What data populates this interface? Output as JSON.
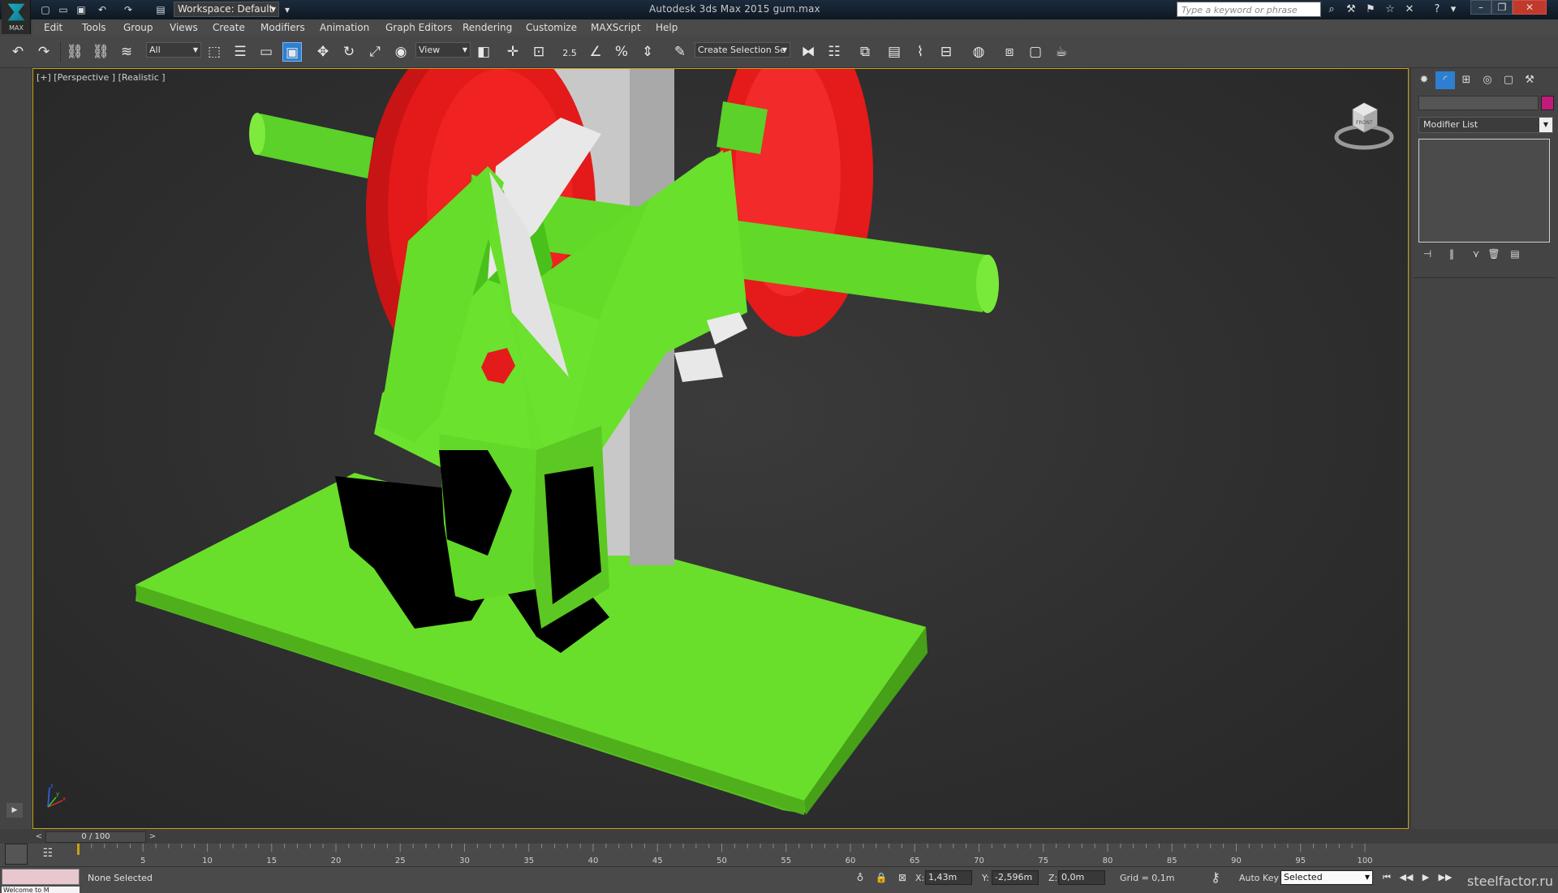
{
  "app": {
    "logo_text": "MAX",
    "window_title": "Autodesk 3ds Max  2015    gum.max",
    "workspace": "Workspace: Default",
    "search_placeholder": "Type a keyword or phrase"
  },
  "menu": [
    "Edit",
    "Tools",
    "Group",
    "Views",
    "Create",
    "Modifiers",
    "Animation",
    "Graph Editors",
    "Rendering",
    "Customize",
    "MAXScript",
    "Help"
  ],
  "toolbar": {
    "selection_filter": "All",
    "ref_coord": "View",
    "snap_value": "2.5",
    "named_selection": "Create Selection Se"
  },
  "viewport": {
    "label": "[+] [Perspective ] [Realistic ]",
    "viewcube_label": "FRONT",
    "axis_labels": [
      "x",
      "y",
      "z"
    ]
  },
  "command_panel": {
    "modifier_list": "Modifier List",
    "name_color": "#c21a7b"
  },
  "timeline": {
    "frame_counter": "0 / 100",
    "prev": "<",
    "next": ">",
    "ticks": [
      "5",
      "10",
      "15",
      "20",
      "25",
      "30",
      "35",
      "40",
      "45",
      "50",
      "55",
      "60",
      "65",
      "70",
      "75",
      "80",
      "85",
      "90",
      "95",
      "100"
    ]
  },
  "status": {
    "selection": "None Selected",
    "script_hint": "Welcome to M",
    "x_label": "X:",
    "x_value": "1,43m",
    "y_label": "Y:",
    "y_value": "-2,596m",
    "z_label": "Z:",
    "z_value": "0,0m",
    "grid": "Grid = 0,1m",
    "autokey": "Auto Key",
    "selected": "Selected",
    "watermark": "steelfactor.ru"
  },
  "colors": {
    "viewport_border": "#c6a017",
    "model_green": "#66dd2a",
    "model_red": "#e01515",
    "accent_blue": "#2e7fd1"
  }
}
